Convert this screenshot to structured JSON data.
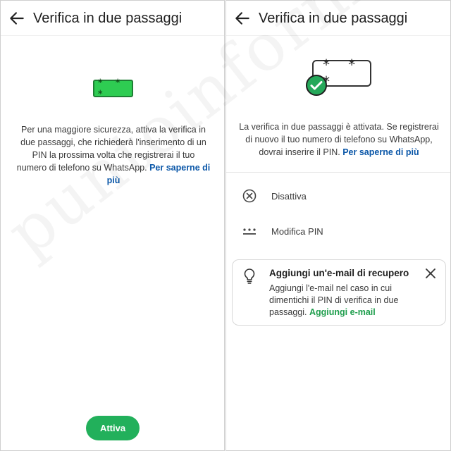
{
  "left": {
    "appbar": {
      "title": "Verifica in due passaggi"
    },
    "pin_badge": "* * *",
    "description": "Per una maggiore sicurezza, attiva la verifica in due passaggi, che richiederà l'inserimento di un PIN la prossima volta che registrerai il tuo numero di telefono su WhatsApp.",
    "learn_more": "Per saperne di più",
    "activate_label": "Attiva"
  },
  "right": {
    "appbar": {
      "title": "Verifica in due passaggi"
    },
    "pin_card": "* * *",
    "description": "La verifica in due passaggi è attivata. Se registrerai di nuovo il tuo numero di telefono su WhatsApp, dovrai inserire il PIN.",
    "learn_more": "Per saperne di più",
    "options": [
      {
        "label": "Disattiva",
        "icon": "circle-x-icon"
      },
      {
        "label": "Modifica PIN",
        "icon": "pin-dots-icon"
      }
    ],
    "recovery_card": {
      "title": "Aggiungi un'e-mail di recupero",
      "body": "Aggiungi l'e-mail nel caso in cui dimentichi il PIN di verifica in due passaggi.",
      "link": "Aggiungi e-mail"
    }
  },
  "watermark": "puntoinformatico",
  "colors": {
    "accent_green": "#22b05b",
    "link_blue": "#0b57a8",
    "check_green": "#25a85a"
  }
}
